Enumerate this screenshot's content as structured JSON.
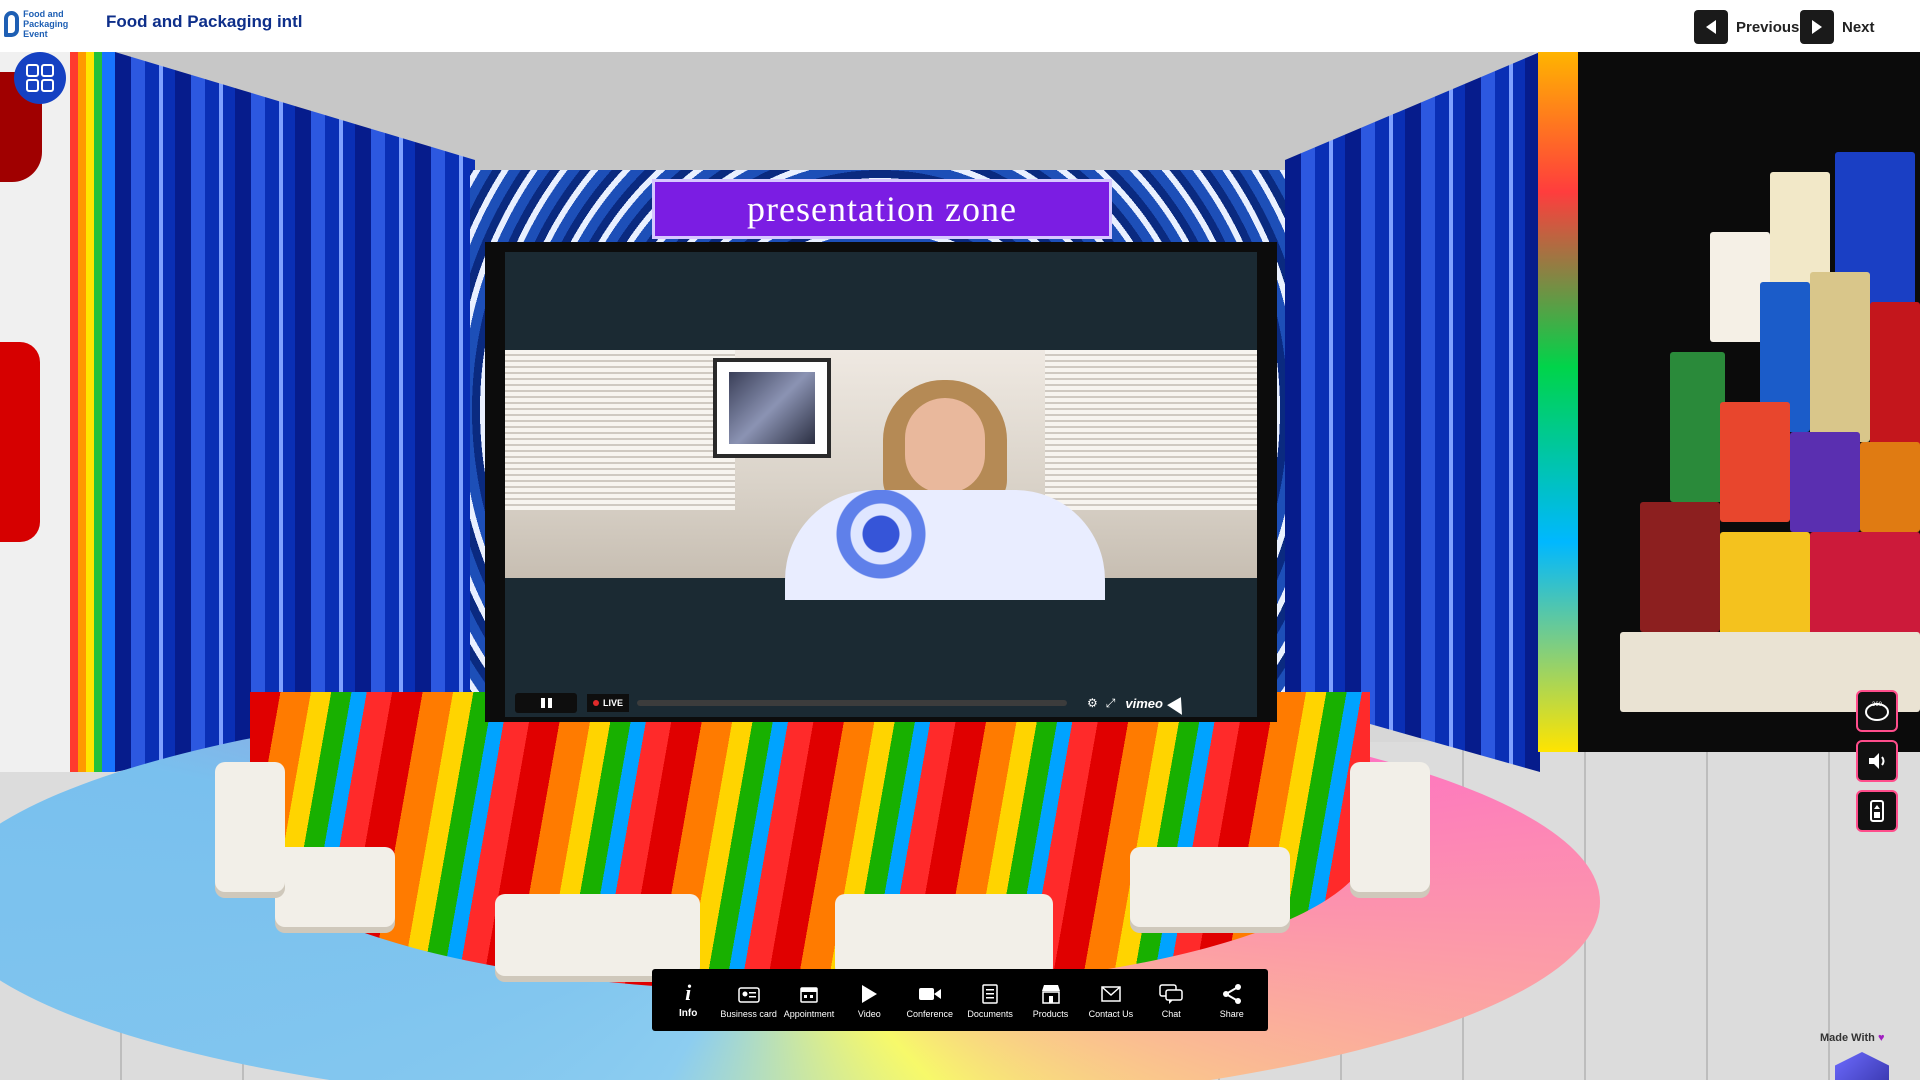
{
  "header": {
    "logo_text": "Food and Packaging Event",
    "title": "Food and Packaging intl",
    "previous_label": "Previous",
    "next_label": "Next"
  },
  "scene": {
    "sign_text": "presentation zone",
    "video": {
      "live_label": "LIVE",
      "brand": "vimeo"
    }
  },
  "side_controls": [
    {
      "name": "360-view",
      "icon": "360-icon"
    },
    {
      "name": "sound",
      "icon": "speaker-icon"
    },
    {
      "name": "elevator",
      "icon": "elevator-icon"
    }
  ],
  "toolbar": [
    {
      "label": "Info",
      "icon": "info-icon"
    },
    {
      "label": "Business card",
      "icon": "business-card-icon"
    },
    {
      "label": "Appointment",
      "icon": "calendar-icon"
    },
    {
      "label": "Video",
      "icon": "play-icon"
    },
    {
      "label": "Conference",
      "icon": "camera-icon"
    },
    {
      "label": "Documents",
      "icon": "document-icon"
    },
    {
      "label": "Products",
      "icon": "store-icon"
    },
    {
      "label": "Contact Us",
      "icon": "envelope-icon"
    },
    {
      "label": "Chat",
      "icon": "chat-icon"
    },
    {
      "label": "Share",
      "icon": "share-icon"
    }
  ],
  "footer": {
    "made_with": "Made With"
  }
}
